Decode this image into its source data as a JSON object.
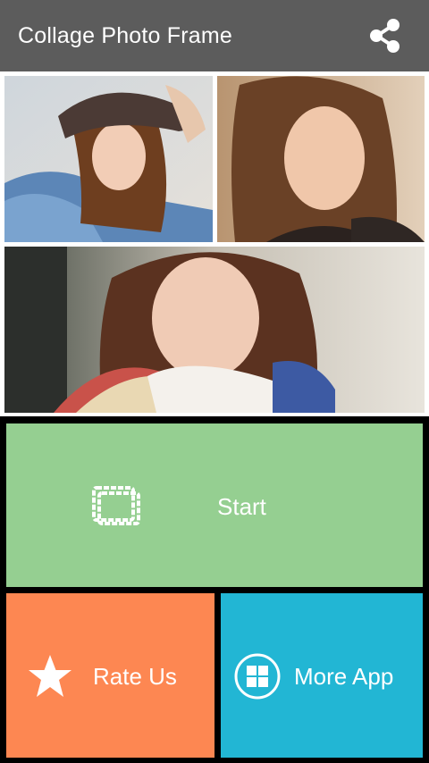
{
  "app": {
    "title": "Collage Photo Frame",
    "share_icon": "share-icon"
  },
  "collage": {
    "photos": [
      {
        "name": "photo-woman-beanie"
      },
      {
        "name": "photo-woman-smiling"
      },
      {
        "name": "photo-woman-portrait"
      }
    ]
  },
  "menu": {
    "start": {
      "label": "Start",
      "icon": "frame-icon",
      "color": "#95cf91"
    },
    "rate": {
      "label": "Rate Us",
      "icon": "star-icon",
      "color": "#fd8752"
    },
    "more": {
      "label": "More App",
      "icon": "grid-icon",
      "color": "#22b6d4"
    }
  },
  "colors": {
    "appbar": "#5c5c5c",
    "background": "#000000"
  }
}
